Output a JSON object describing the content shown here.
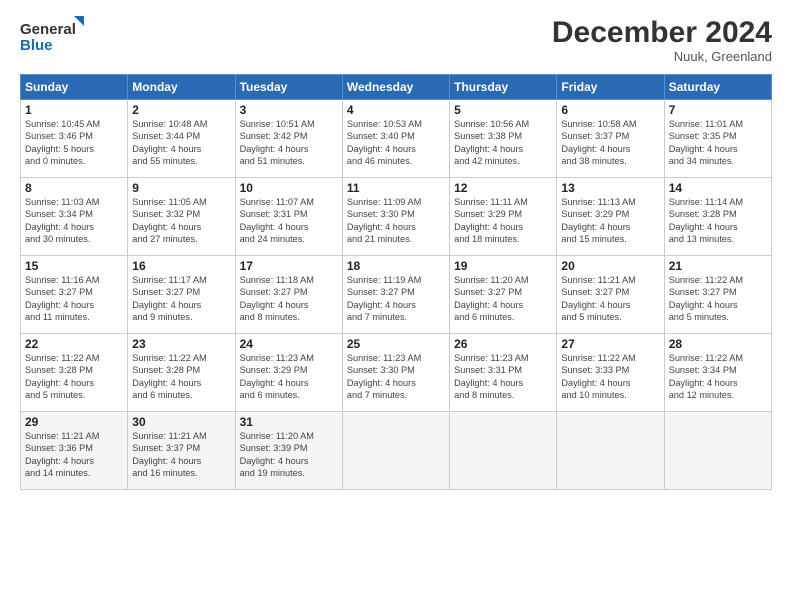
{
  "header": {
    "logo_line1": "General",
    "logo_line2": "Blue",
    "month_title": "December 2024",
    "location": "Nuuk, Greenland"
  },
  "days_of_week": [
    "Sunday",
    "Monday",
    "Tuesday",
    "Wednesday",
    "Thursday",
    "Friday",
    "Saturday"
  ],
  "weeks": [
    [
      {
        "day": "1",
        "text": "Sunrise: 10:45 AM\nSunset: 3:46 PM\nDaylight: 5 hours\nand 0 minutes."
      },
      {
        "day": "2",
        "text": "Sunrise: 10:48 AM\nSunset: 3:44 PM\nDaylight: 4 hours\nand 55 minutes."
      },
      {
        "day": "3",
        "text": "Sunrise: 10:51 AM\nSunset: 3:42 PM\nDaylight: 4 hours\nand 51 minutes."
      },
      {
        "day": "4",
        "text": "Sunrise: 10:53 AM\nSunset: 3:40 PM\nDaylight: 4 hours\nand 46 minutes."
      },
      {
        "day": "5",
        "text": "Sunrise: 10:56 AM\nSunset: 3:38 PM\nDaylight: 4 hours\nand 42 minutes."
      },
      {
        "day": "6",
        "text": "Sunrise: 10:58 AM\nSunset: 3:37 PM\nDaylight: 4 hours\nand 38 minutes."
      },
      {
        "day": "7",
        "text": "Sunrise: 11:01 AM\nSunset: 3:35 PM\nDaylight: 4 hours\nand 34 minutes."
      }
    ],
    [
      {
        "day": "8",
        "text": "Sunrise: 11:03 AM\nSunset: 3:34 PM\nDaylight: 4 hours\nand 30 minutes."
      },
      {
        "day": "9",
        "text": "Sunrise: 11:05 AM\nSunset: 3:32 PM\nDaylight: 4 hours\nand 27 minutes."
      },
      {
        "day": "10",
        "text": "Sunrise: 11:07 AM\nSunset: 3:31 PM\nDaylight: 4 hours\nand 24 minutes."
      },
      {
        "day": "11",
        "text": "Sunrise: 11:09 AM\nSunset: 3:30 PM\nDaylight: 4 hours\nand 21 minutes."
      },
      {
        "day": "12",
        "text": "Sunrise: 11:11 AM\nSunset: 3:29 PM\nDaylight: 4 hours\nand 18 minutes."
      },
      {
        "day": "13",
        "text": "Sunrise: 11:13 AM\nSunset: 3:29 PM\nDaylight: 4 hours\nand 15 minutes."
      },
      {
        "day": "14",
        "text": "Sunrise: 11:14 AM\nSunset: 3:28 PM\nDaylight: 4 hours\nand 13 minutes."
      }
    ],
    [
      {
        "day": "15",
        "text": "Sunrise: 11:16 AM\nSunset: 3:27 PM\nDaylight: 4 hours\nand 11 minutes."
      },
      {
        "day": "16",
        "text": "Sunrise: 11:17 AM\nSunset: 3:27 PM\nDaylight: 4 hours\nand 9 minutes."
      },
      {
        "day": "17",
        "text": "Sunrise: 11:18 AM\nSunset: 3:27 PM\nDaylight: 4 hours\nand 8 minutes."
      },
      {
        "day": "18",
        "text": "Sunrise: 11:19 AM\nSunset: 3:27 PM\nDaylight: 4 hours\nand 7 minutes."
      },
      {
        "day": "19",
        "text": "Sunrise: 11:20 AM\nSunset: 3:27 PM\nDaylight: 4 hours\nand 6 minutes."
      },
      {
        "day": "20",
        "text": "Sunrise: 11:21 AM\nSunset: 3:27 PM\nDaylight: 4 hours\nand 5 minutes."
      },
      {
        "day": "21",
        "text": "Sunrise: 11:22 AM\nSunset: 3:27 PM\nDaylight: 4 hours\nand 5 minutes."
      }
    ],
    [
      {
        "day": "22",
        "text": "Sunrise: 11:22 AM\nSunset: 3:28 PM\nDaylight: 4 hours\nand 5 minutes."
      },
      {
        "day": "23",
        "text": "Sunrise: 11:22 AM\nSunset: 3:28 PM\nDaylight: 4 hours\nand 6 minutes."
      },
      {
        "day": "24",
        "text": "Sunrise: 11:23 AM\nSunset: 3:29 PM\nDaylight: 4 hours\nand 6 minutes."
      },
      {
        "day": "25",
        "text": "Sunrise: 11:23 AM\nSunset: 3:30 PM\nDaylight: 4 hours\nand 7 minutes."
      },
      {
        "day": "26",
        "text": "Sunrise: 11:23 AM\nSunset: 3:31 PM\nDaylight: 4 hours\nand 8 minutes."
      },
      {
        "day": "27",
        "text": "Sunrise: 11:22 AM\nSunset: 3:33 PM\nDaylight: 4 hours\nand 10 minutes."
      },
      {
        "day": "28",
        "text": "Sunrise: 11:22 AM\nSunset: 3:34 PM\nDaylight: 4 hours\nand 12 minutes."
      }
    ],
    [
      {
        "day": "29",
        "text": "Sunrise: 11:21 AM\nSunset: 3:36 PM\nDaylight: 4 hours\nand 14 minutes."
      },
      {
        "day": "30",
        "text": "Sunrise: 11:21 AM\nSunset: 3:37 PM\nDaylight: 4 hours\nand 16 minutes."
      },
      {
        "day": "31",
        "text": "Sunrise: 11:20 AM\nSunset: 3:39 PM\nDaylight: 4 hours\nand 19 minutes."
      },
      {
        "day": "",
        "text": ""
      },
      {
        "day": "",
        "text": ""
      },
      {
        "day": "",
        "text": ""
      },
      {
        "day": "",
        "text": ""
      }
    ]
  ]
}
